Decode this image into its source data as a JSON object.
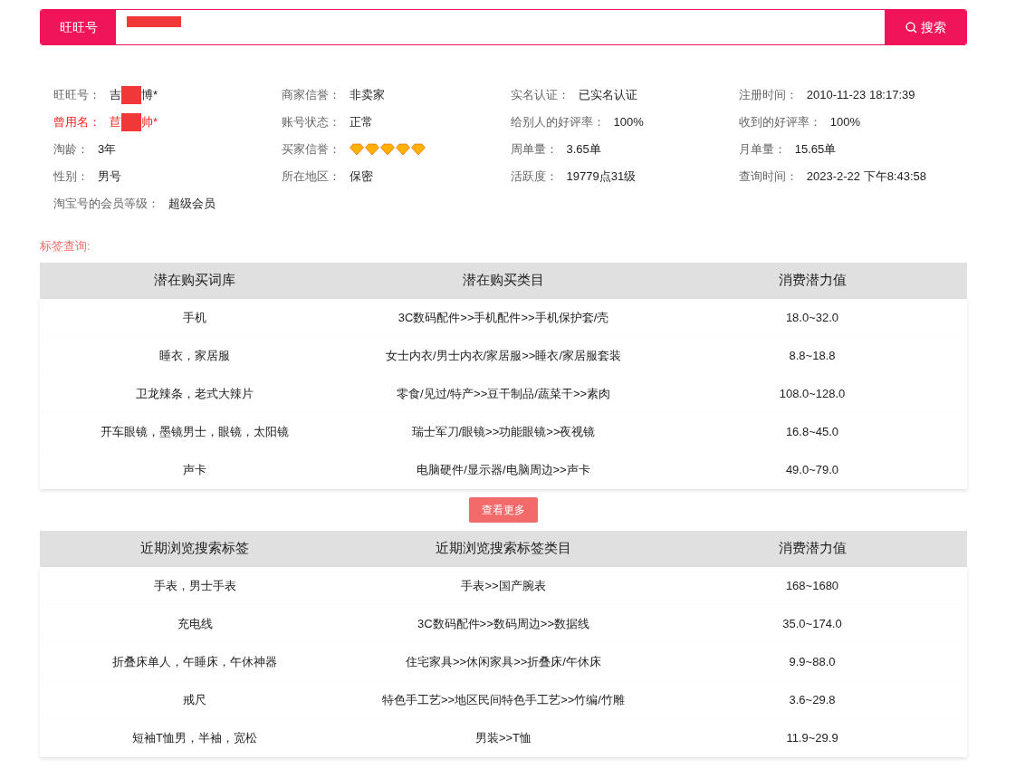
{
  "search": {
    "label": "旺旺号",
    "redacted": true,
    "button": "搜索"
  },
  "info": [
    {
      "label": "旺旺号：",
      "value": "吉",
      "value_end": "博*",
      "redacted": true,
      "highlight": false
    },
    {
      "label": "商家信誉：",
      "value": "非卖家",
      "redacted": false,
      "highlight": false
    },
    {
      "label": "实名认证：",
      "value": "已实名认证",
      "redacted": false,
      "highlight": false
    },
    {
      "label": "注册时间：",
      "value": "2010-11-23 18:17:39",
      "redacted": false,
      "highlight": false
    },
    {
      "label": "曾用名：",
      "value": "苣",
      "value_end": "帅*",
      "redacted": true,
      "highlight": true
    },
    {
      "label": "账号状态：",
      "value": "正常",
      "redacted": false,
      "highlight": false
    },
    {
      "label": "给别人的好评率：",
      "value": "100%",
      "redacted": false,
      "highlight": false
    },
    {
      "label": "收到的好评率：",
      "value": "100%",
      "redacted": false,
      "highlight": false
    },
    {
      "label": "淘龄：",
      "value": "3年",
      "redacted": false,
      "highlight": false
    },
    {
      "label": "买家信誉：",
      "kind": "diamonds",
      "stars": 5,
      "highlight": false
    },
    {
      "label": "周单量：",
      "value": "3.65单",
      "redacted": false,
      "highlight": false
    },
    {
      "label": "月单量：",
      "value": "15.65单",
      "redacted": false,
      "highlight": false
    },
    {
      "label": "性别：",
      "value": "男号",
      "redacted": false,
      "highlight": false
    },
    {
      "label": "所在地区：",
      "value": "保密",
      "redacted": false,
      "highlight": false
    },
    {
      "label": "活跃度：",
      "value": "19779点31级",
      "redacted": false,
      "highlight": false
    },
    {
      "label": "查询时间：",
      "value": "2023-2-22 下午8:43:58",
      "redacted": false,
      "highlight": false
    },
    {
      "label": "淘宝号的会员等级：",
      "value": "超级会员",
      "redacted": false,
      "highlight": false
    }
  ],
  "section_title": "标签查询:",
  "tables": [
    {
      "columns": [
        "潜在购买词库",
        "潜在购买类目",
        "消费潜力值"
      ],
      "rows": [
        [
          "手机",
          "3C数码配件>>手机配件>>手机保护套/壳",
          "18.0~32.0"
        ],
        [
          "睡衣，家居服",
          "女士内衣/男士内衣/家居服>>睡衣/家居服套装",
          "8.8~18.8"
        ],
        [
          "卫龙辣条，老式大辣片",
          "零食/见过/特产>>豆干制品/蔬菜干>>素肉",
          "108.0~128.0"
        ],
        [
          "开车眼镜，墨镜男士，眼镜，太阳镜",
          "瑞士军刀/眼镜>>功能眼镜>>夜视镜",
          "16.8~45.0"
        ],
        [
          "声卡",
          "电脑硬件/显示器/电脑周边>>声卡",
          "49.0~79.0"
        ]
      ],
      "more_button": "查看更多"
    },
    {
      "columns": [
        "近期浏览搜索标签",
        "近期浏览搜索标签类目",
        "消费潜力值"
      ],
      "rows": [
        [
          "手表，男士手表",
          "手表>>国产腕表",
          "168~1680"
        ],
        [
          "充电线",
          "3C数码配件>>数码周边>>数据线",
          "35.0~174.0"
        ],
        [
          "折叠床单人，午睡床，午休神器",
          "住宅家具>>休闲家具>>折叠床/午休床",
          "9.9~88.0"
        ],
        [
          "戒尺",
          "特色手工艺>>地区民间特色手工艺>>竹编/竹雕",
          "3.6~29.8"
        ],
        [
          "短袖T恤男，半袖，宽松",
          "男装>>T恤",
          "11.9~29.9"
        ]
      ]
    }
  ]
}
